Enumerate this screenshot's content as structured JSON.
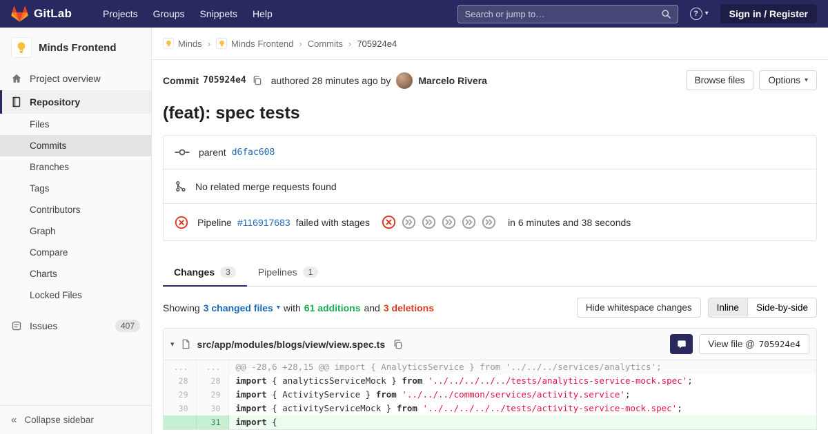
{
  "navbar": {
    "brand": "GitLab",
    "menu": [
      "Projects",
      "Groups",
      "Snippets",
      "Help"
    ],
    "search_placeholder": "Search or jump to…",
    "signin_label": "Sign in / Register"
  },
  "sidebar": {
    "project_name": "Minds Frontend",
    "overview_label": "Project overview",
    "repository_label": "Repository",
    "repo_subitems": [
      "Files",
      "Commits",
      "Branches",
      "Tags",
      "Contributors",
      "Graph",
      "Compare",
      "Charts",
      "Locked Files"
    ],
    "active_subitem": "Commits",
    "issues_label": "Issues",
    "issues_count": "407",
    "collapse_label": "Collapse sidebar"
  },
  "breadcrumb": [
    "Minds",
    "Minds Frontend",
    "Commits",
    "705924e4"
  ],
  "commit_header": {
    "commit_label": "Commit",
    "sha": "705924e4",
    "authored_text": "authored 28 minutes ago by",
    "author": "Marcelo Rivera",
    "browse_files_label": "Browse files",
    "options_label": "Options"
  },
  "commit": {
    "title": "(feat): spec tests",
    "parent_label": "parent",
    "parent_sha": "d6fac608",
    "no_mr_text": "No related merge requests found",
    "pipeline": {
      "prefix": "Pipeline",
      "id": "#116917683",
      "status_text": "failed with stages",
      "stages": [
        "failed",
        "skipped",
        "skipped",
        "skipped",
        "skipped",
        "skipped"
      ],
      "duration_text": "in 6 minutes and 38 seconds"
    }
  },
  "tabs": [
    {
      "label": "Changes",
      "count": "3",
      "active": true
    },
    {
      "label": "Pipelines",
      "count": "1",
      "active": false
    }
  ],
  "summary": {
    "showing_label": "Showing",
    "changed_files": "3 changed files",
    "with_label": "with",
    "additions": "61 additions",
    "and_label": "and",
    "deletions": "3 deletions",
    "hide_whitespace_label": "Hide whitespace changes",
    "inline_label": "Inline",
    "side_by_side_label": "Side-by-side"
  },
  "diff": {
    "file_path": "src/app/modules/blogs/view/view.spec.ts",
    "view_file_prefix": "View file @",
    "view_file_sha": "705924e4",
    "lines": [
      {
        "type": "hunk",
        "old": "...",
        "new": "...",
        "segments": [
          {
            "type": "plain",
            "text": "@@ -28,6 +28,15 @@ import { AnalyticsService } from '../../../services/analytics';"
          }
        ]
      },
      {
        "type": "context",
        "old": "28",
        "new": "28",
        "segments": [
          {
            "type": "keyword",
            "text": "import"
          },
          {
            "type": "plain",
            "text": " { analyticsServiceMock } "
          },
          {
            "type": "keyword",
            "text": "from"
          },
          {
            "type": "plain",
            "text": " "
          },
          {
            "type": "string",
            "text": "'../../../../../tests/analytics-service-mock.spec'"
          },
          {
            "type": "plain",
            "text": ";"
          }
        ]
      },
      {
        "type": "context",
        "old": "29",
        "new": "29",
        "segments": [
          {
            "type": "keyword",
            "text": "import"
          },
          {
            "type": "plain",
            "text": " { ActivityService } "
          },
          {
            "type": "keyword",
            "text": "from"
          },
          {
            "type": "plain",
            "text": " "
          },
          {
            "type": "string",
            "text": "'../../../common/services/activity.service'"
          },
          {
            "type": "plain",
            "text": ";"
          }
        ]
      },
      {
        "type": "context",
        "old": "30",
        "new": "30",
        "segments": [
          {
            "type": "keyword",
            "text": "import"
          },
          {
            "type": "plain",
            "text": " { activityServiceMock } "
          },
          {
            "type": "keyword",
            "text": "from"
          },
          {
            "type": "plain",
            "text": " "
          },
          {
            "type": "string",
            "text": "'../../../../../tests/activity-service-mock.spec'"
          },
          {
            "type": "plain",
            "text": ";"
          }
        ]
      },
      {
        "type": "add",
        "old": "",
        "new": "31",
        "segments": [
          {
            "type": "keyword",
            "text": "import"
          },
          {
            "type": "plain",
            "text": " { "
          }
        ]
      }
    ]
  },
  "colors": {
    "navbar_bg": "#292961",
    "link": "#1b69b6",
    "success": "#1aaa55",
    "danger": "#db3b21",
    "tanuki": [
      "#e24329",
      "#fc6d26",
      "#fca326"
    ]
  }
}
